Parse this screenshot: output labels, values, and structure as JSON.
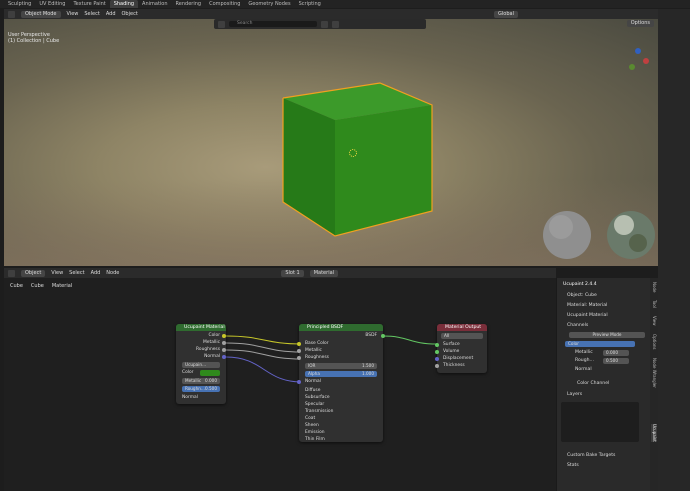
{
  "workspace_tabs": [
    {
      "label": "Sculpting",
      "active": false
    },
    {
      "label": "UV Editing",
      "active": false
    },
    {
      "label": "Texture Paint",
      "active": false
    },
    {
      "label": "Shading",
      "active": true
    },
    {
      "label": "Animation",
      "active": false
    },
    {
      "label": "Rendering",
      "active": false
    },
    {
      "label": "Compositing",
      "active": false
    },
    {
      "label": "Geometry Nodes",
      "active": false
    },
    {
      "label": "Scripting",
      "active": false
    }
  ],
  "viewport": {
    "mode": "Object Mode",
    "menus": [
      "View",
      "Select",
      "Add",
      "Object"
    ],
    "transform_orientation": "Global",
    "search_placeholder": "Search",
    "options_label": "Options",
    "info_line1": "User Perspective",
    "info_line2": "(1) Collection | Cube",
    "cube_color": "#2f8a1c",
    "outline_color": "#f0a020"
  },
  "node_editor": {
    "mode": "Object",
    "menus": [
      "View",
      "Select",
      "Add",
      "Node"
    ],
    "slot": "Slot 1",
    "material": "Material",
    "breadcrumb": [
      "Cube",
      "Cube",
      "Material"
    ]
  },
  "nodes": {
    "ucupaint": {
      "title": "Ucupaint Material",
      "outputs": [
        "Color",
        "Metallic",
        "Roughness",
        "Normal"
      ],
      "group_name": "Ucupain...",
      "color_label": "Color",
      "metallic_label": "Metallic",
      "metallic_value": "0.000",
      "roughness_label": "Roughn...",
      "roughness_value": "0.500",
      "normal_label": "Normal"
    },
    "bsdf": {
      "title": "Principled BSDF",
      "output": "BSDF",
      "inputs": [
        "Base Color",
        "Metallic",
        "Roughness"
      ],
      "ior_label": "IOR",
      "ior_value": "1.500",
      "alpha_label": "Alpha",
      "alpha_value": "1.000",
      "normal_label": "Normal",
      "sections": [
        "Diffuse",
        "Subsurface",
        "Specular",
        "Transmission",
        "Coat",
        "Sheen",
        "Emission",
        "Thin Film"
      ]
    },
    "output": {
      "title": "Material Output",
      "target": "All",
      "inputs": [
        "Surface",
        "Volume",
        "Displacement",
        "Thickness"
      ]
    }
  },
  "npanel": {
    "title": "Ucupaint 2.4.4",
    "object": "Object: Cube",
    "material": "Material: Material",
    "ucupaint_material": "Ucupaint Material",
    "channels_label": "Channels",
    "preview_mode": "Preview Mode",
    "channels": [
      "Color",
      "Metallic",
      "Rough...",
      "Normal"
    ],
    "metallic_value": "0.000",
    "roughness_value": "0.500",
    "color_channel": "Color Channel",
    "layers_label": "Layers",
    "custom_bake": "Custom Bake Targets",
    "stats": "Stats",
    "tabs": [
      "Node",
      "Tool",
      "View",
      "Options",
      "Node Wrangler",
      "Ucupaint"
    ]
  }
}
